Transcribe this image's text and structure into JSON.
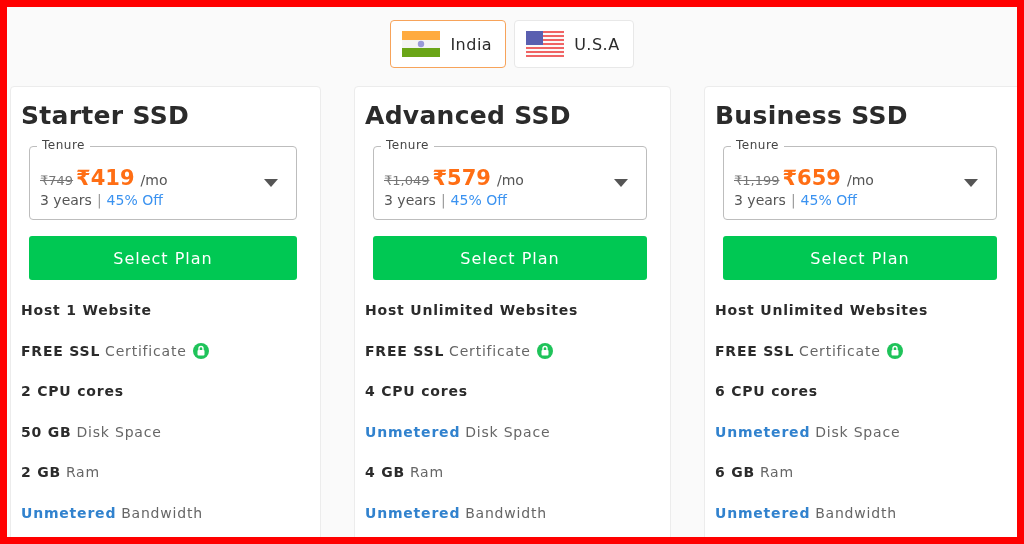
{
  "countries": [
    {
      "label": "India",
      "selected": true
    },
    {
      "label": "U.S.A",
      "selected": false
    }
  ],
  "plans": [
    {
      "name": "Starter SSD",
      "tenure": {
        "label": "Tenure",
        "old_price": "₹749",
        "price": "₹419",
        "unit": "/mo",
        "term": "3 years",
        "separator": "|",
        "discount": "45% Off"
      },
      "button": "Select Plan",
      "features": [
        {
          "strong": "Host 1 Website",
          "highlight": false,
          "lock": false
        },
        {
          "strong": "FREE SSL",
          "text": "Certificate",
          "highlight": false,
          "lock": true
        },
        {
          "strong": "2 CPU cores",
          "highlight": false,
          "lock": false
        },
        {
          "strong": "50 GB",
          "text": "Disk Space",
          "highlight": false,
          "lock": false
        },
        {
          "strong": "2 GB",
          "text": "Ram",
          "highlight": false,
          "lock": false
        },
        {
          "strong": "Unmetered",
          "text": "Bandwidth",
          "highlight": true,
          "lock": false
        }
      ]
    },
    {
      "name": "Advanced SSD",
      "tenure": {
        "label": "Tenure",
        "old_price": "₹1,049",
        "price": "₹579",
        "unit": "/mo",
        "term": "3 years",
        "separator": "|",
        "discount": "45% Off"
      },
      "button": "Select Plan",
      "features": [
        {
          "strong": "Host Unlimited Websites",
          "highlight": false,
          "lock": false
        },
        {
          "strong": "FREE SSL",
          "text": "Certificate",
          "highlight": false,
          "lock": true
        },
        {
          "strong": "4 CPU cores",
          "highlight": false,
          "lock": false
        },
        {
          "strong": "Unmetered",
          "text": "Disk Space",
          "highlight": true,
          "lock": false
        },
        {
          "strong": "4 GB",
          "text": "Ram",
          "highlight": false,
          "lock": false
        },
        {
          "strong": "Unmetered",
          "text": "Bandwidth",
          "highlight": true,
          "lock": false
        }
      ]
    },
    {
      "name": "Business SSD",
      "tenure": {
        "label": "Tenure",
        "old_price": "₹1,199",
        "price": "₹659",
        "unit": "/mo",
        "term": "3 years",
        "separator": "|",
        "discount": "45% Off"
      },
      "button": "Select Plan",
      "features": [
        {
          "strong": "Host Unlimited Websites",
          "highlight": false,
          "lock": false
        },
        {
          "strong": "FREE SSL",
          "text": "Certificate",
          "highlight": false,
          "lock": true
        },
        {
          "strong": "6 CPU cores",
          "highlight": false,
          "lock": false
        },
        {
          "strong": "Unmetered",
          "text": "Disk Space",
          "highlight": true,
          "lock": false
        },
        {
          "strong": "6 GB",
          "text": "Ram",
          "highlight": false,
          "lock": false
        },
        {
          "strong": "Unmetered",
          "text": "Bandwidth",
          "highlight": true,
          "lock": false
        }
      ]
    }
  ]
}
